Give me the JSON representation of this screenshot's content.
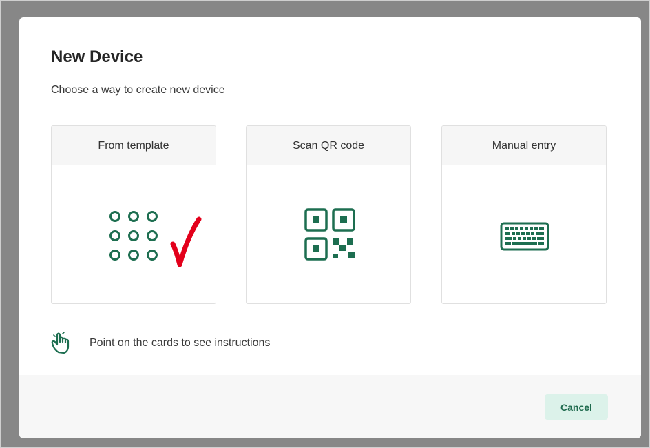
{
  "dialog": {
    "title": "New Device",
    "subtitle": "Choose a way to create new device"
  },
  "cards": [
    {
      "label": "From template",
      "icon": "grid-dots-icon"
    },
    {
      "label": "Scan QR code",
      "icon": "qr-code-icon"
    },
    {
      "label": "Manual entry",
      "icon": "keyboard-icon"
    }
  ],
  "annotation": {
    "icon": "red-check-mark-icon",
    "color": "#e3001b"
  },
  "hint": {
    "text": "Point on the cards to see instructions",
    "icon": "pointing-hand-icon"
  },
  "footer": {
    "cancel_label": "Cancel"
  },
  "colors": {
    "accent": "#1d6e50",
    "button_bg": "#dcf2ea"
  }
}
